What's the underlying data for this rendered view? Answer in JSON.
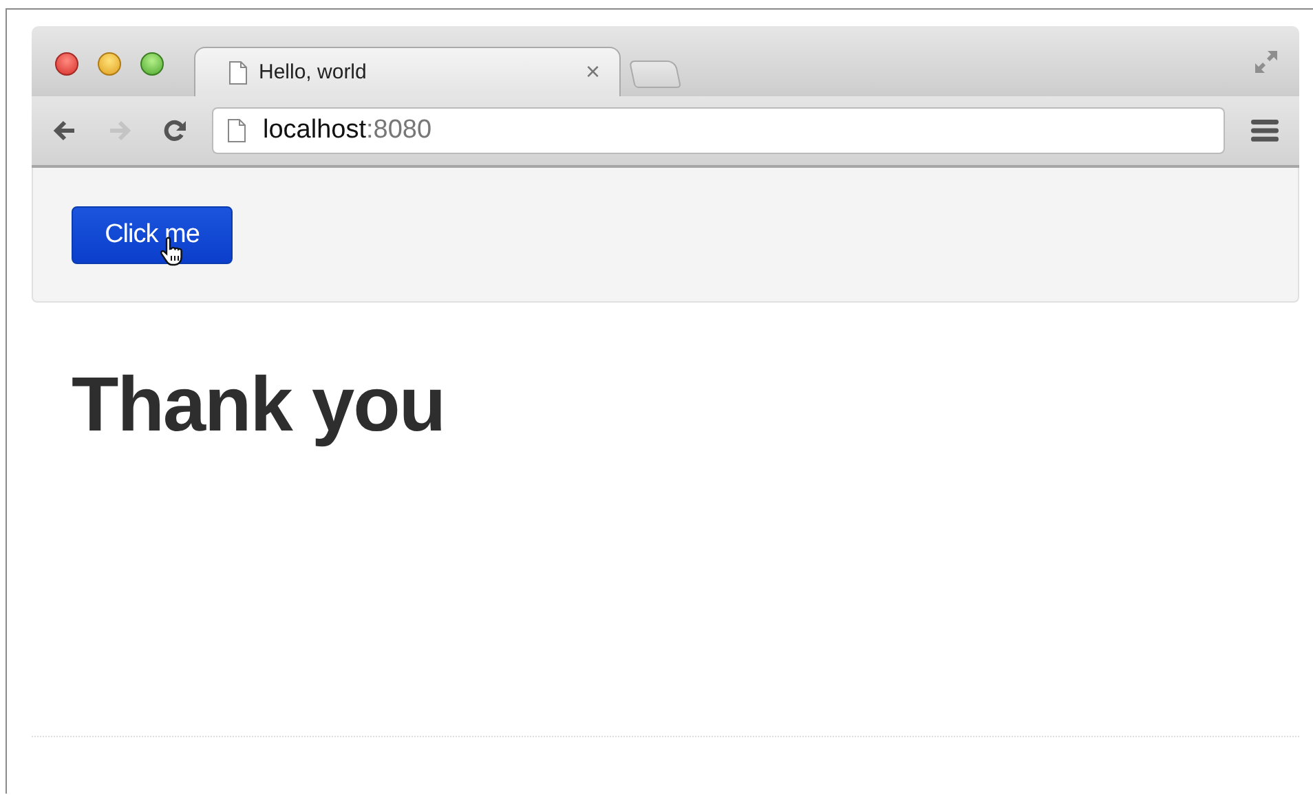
{
  "tabs": [
    {
      "title": "Hello, world",
      "close": "×",
      "selected": true
    }
  ],
  "nav": [
    {
      "kind": "back",
      "disabled": false
    },
    {
      "kind": "forward",
      "disabled": true
    },
    {
      "kind": "reload",
      "disabled": false
    }
  ],
  "address": {
    "host": "localhost",
    "port": ":8080"
  },
  "page": {
    "button": "Click me",
    "heading": "Thank you"
  }
}
